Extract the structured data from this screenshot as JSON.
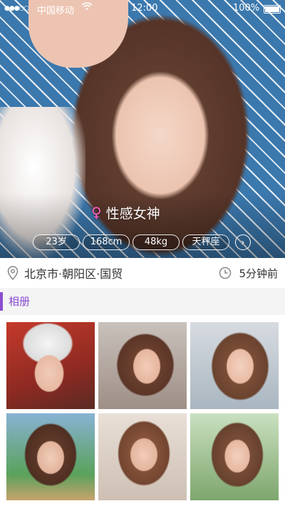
{
  "status_bar": {
    "signal": "●●●○○",
    "carrier": "中国移动",
    "time": "12:00",
    "battery": "100%"
  },
  "profile": {
    "nickname": "性感女神",
    "gender_icon": "female-symbol-icon",
    "tags": [
      "23岁",
      "168cm",
      "48kg",
      "天秤座"
    ],
    "location": "北京市·朝阳区·国贸",
    "last_active": "5分钟前"
  },
  "album": {
    "title": "相册",
    "accent_color": "#8a4cd0",
    "photos": [
      {
        "name": "album-photo-1"
      },
      {
        "name": "album-photo-2"
      },
      {
        "name": "album-photo-3"
      },
      {
        "name": "album-photo-4"
      },
      {
        "name": "album-photo-5"
      },
      {
        "name": "album-photo-6"
      }
    ]
  }
}
